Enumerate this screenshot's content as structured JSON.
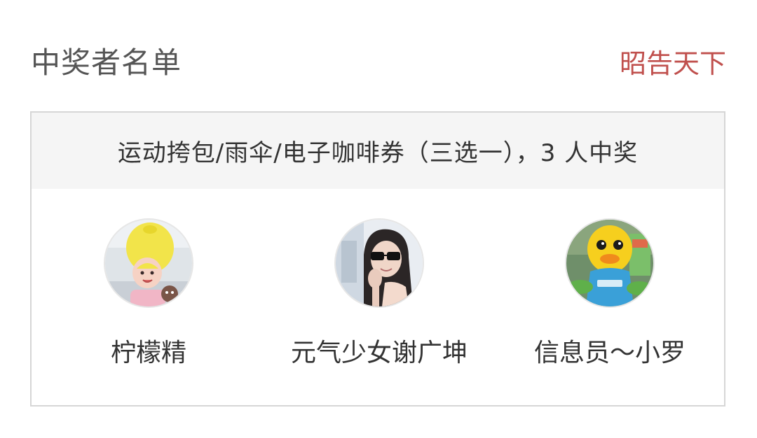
{
  "header": {
    "title": "中奖者名单",
    "action_label": "昭告天下"
  },
  "prize": {
    "description": "运动挎包/雨伞/电子咖啡券（三选一），3 人中奖"
  },
  "winners": [
    {
      "name": "柠檬精",
      "avatar_icon": "lemon-hat-avatar"
    },
    {
      "name": "元气少女谢广坤",
      "avatar_icon": "sunglasses-avatar"
    },
    {
      "name": "信息员～小罗",
      "avatar_icon": "yellow-duck-avatar"
    }
  ],
  "colors": {
    "title": "#555555",
    "accent": "#c0504d",
    "card_border": "#d6d6d6",
    "card_head_bg": "#f5f5f5",
    "text": "#333333"
  }
}
